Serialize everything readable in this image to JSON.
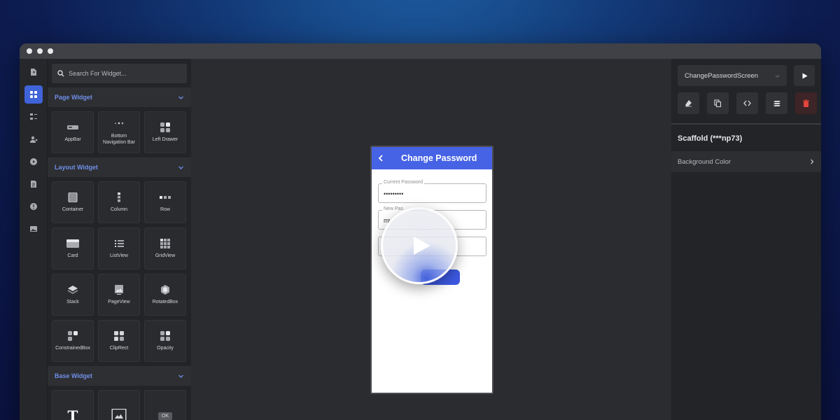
{
  "window": {
    "controls": [
      "close-dot",
      "minimize-dot",
      "maximize-dot"
    ]
  },
  "rail": {
    "items": [
      {
        "icon": "page-add-icon",
        "active": false
      },
      {
        "icon": "widgets-icon",
        "active": true
      },
      {
        "icon": "layers-icon",
        "active": false
      },
      {
        "icon": "user-settings-icon",
        "active": false
      },
      {
        "icon": "play-circle-icon",
        "active": false
      },
      {
        "icon": "document-icon",
        "active": false
      },
      {
        "icon": "info-icon",
        "active": false
      },
      {
        "icon": "image-icon",
        "active": false
      }
    ]
  },
  "panel": {
    "search_placeholder": "Search For Widget...",
    "sections": {
      "page": {
        "title": "Page Widget",
        "items": [
          "AppBar",
          "Bottom Navigation Bar",
          "Left Drawer"
        ]
      },
      "layout": {
        "title": "Layout Widget",
        "items": [
          "Container",
          "Column",
          "Row",
          "Card",
          "ListView",
          "GridView",
          "Stack",
          "PageView",
          "RotatedBox",
          "ConstrainedBox",
          "ClipRect",
          "Opacity"
        ]
      },
      "base": {
        "title": "Base Widget",
        "items": [
          "T",
          "",
          "OK"
        ]
      }
    }
  },
  "phone": {
    "title": "Change Password",
    "fields": [
      {
        "legend": "Current Password",
        "value": "•••••••••"
      },
      {
        "legend": "New Pas",
        "value": "my"
      },
      {
        "legend": "",
        "value": ""
      }
    ]
  },
  "props": {
    "screen": "ChangePasswordScreen",
    "selected": "Scaffold (***np73)",
    "rows": [
      "Background Color"
    ]
  },
  "colors": {
    "accent": "#4662e5",
    "section_title": "#6f8fe8",
    "danger": "#e2463f"
  }
}
